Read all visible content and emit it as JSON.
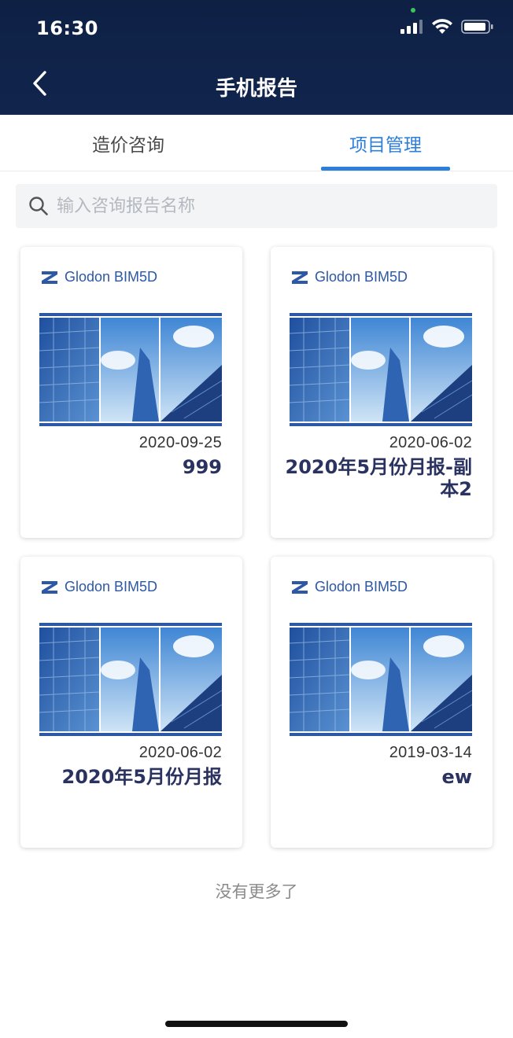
{
  "status_bar": {
    "time": "16:30"
  },
  "header": {
    "title": "手机报告"
  },
  "tabs": [
    {
      "label": "造价咨询",
      "active": false
    },
    {
      "label": "项目管理",
      "active": true
    }
  ],
  "search": {
    "placeholder": "输入咨询报告名称"
  },
  "reports": [
    {
      "brand": "Glodon BIM5D",
      "date": "2020-09-25",
      "name": "999"
    },
    {
      "brand": "Glodon BIM5D",
      "date": "2020-06-02",
      "name": "2020年5月份月报-副本2"
    },
    {
      "brand": "Glodon BIM5D",
      "date": "2020-06-02",
      "name": "2020年5月份月报"
    },
    {
      "brand": "Glodon BIM5D",
      "date": "2019-03-14",
      "name": "ew"
    }
  ],
  "footer": {
    "no_more": "没有更多了"
  },
  "colors": {
    "header_bg": "#0e2044",
    "accent": "#2e7fd9",
    "title_text": "#2a3360"
  }
}
